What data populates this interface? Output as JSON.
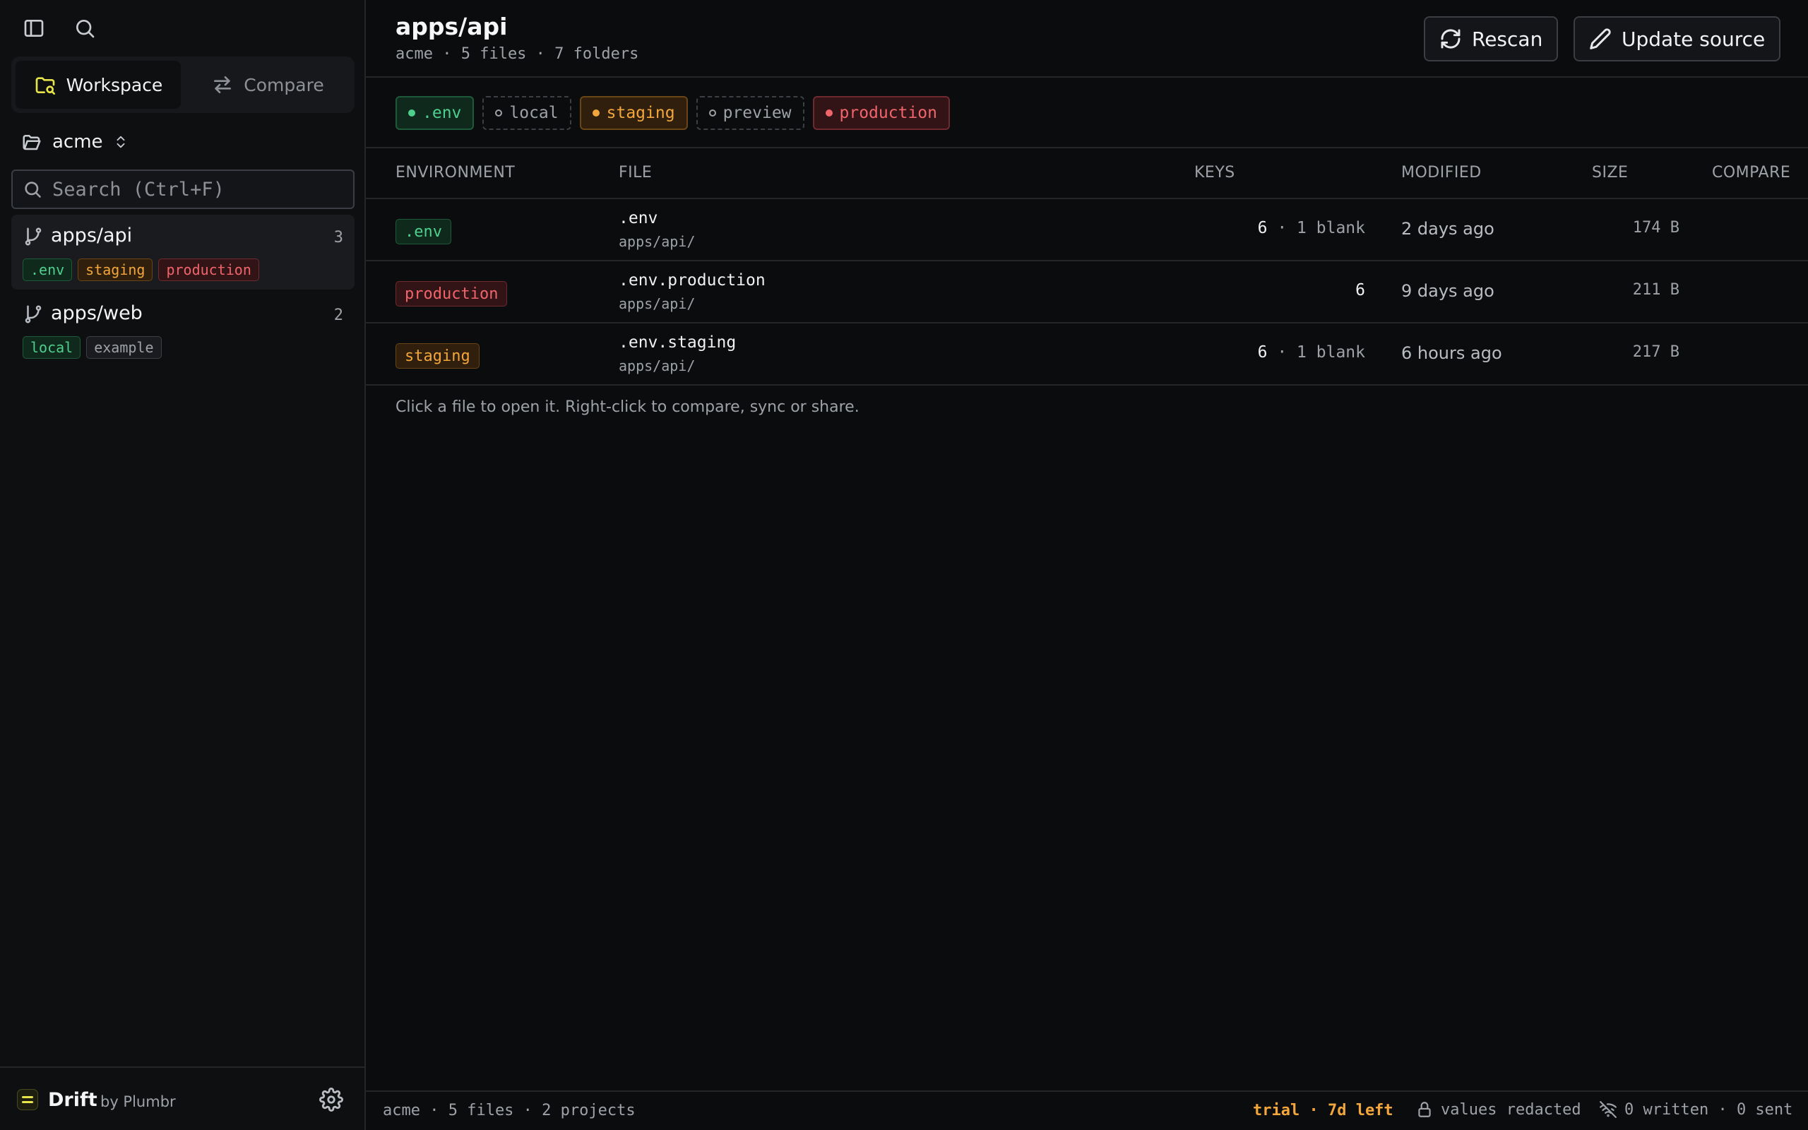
{
  "sidebar": {
    "segments": [
      {
        "label": "Workspace",
        "icon": "folder-search-icon",
        "active": true
      },
      {
        "label": "Compare",
        "icon": "arrows-swap-icon",
        "active": false
      }
    ],
    "workspace": "acme",
    "search": {
      "placeholder": "Search (Ctrl+F)",
      "value": ""
    },
    "projects": [
      {
        "name": "apps/api",
        "count": "3",
        "tags": [
          ".env",
          "staging",
          "production"
        ]
      },
      {
        "name": "apps/web",
        "count": "2",
        "tags": [
          "local",
          "example"
        ]
      }
    ],
    "footer": {
      "brand": "Drift",
      "byline": "by Plumbr"
    }
  },
  "header": {
    "title": "apps/api",
    "subtitle": "acme · 5 files · 7 folders",
    "rescan_label": "Rescan",
    "update_label": "Update source"
  },
  "env_chips": [
    {
      "label": ".env",
      "style": "green"
    },
    {
      "label": "local",
      "style": "dashed"
    },
    {
      "label": "staging",
      "style": "orange"
    },
    {
      "label": "preview",
      "style": "dashed"
    },
    {
      "label": "production",
      "style": "red"
    }
  ],
  "table": {
    "columns": {
      "environment": "ENVIRONMENT",
      "file": "FILE",
      "keys": "KEYS",
      "modified": "MODIFIED",
      "size": "SIZE",
      "compare": "COMPARE"
    },
    "rows": [
      {
        "env": ".env",
        "file": ".env",
        "path": "apps/api/",
        "keys": "6",
        "blank": " · 1 blank",
        "modified": "2 days ago",
        "size": "174 B"
      },
      {
        "env": "production",
        "file": ".env.production",
        "path": "apps/api/",
        "keys": "6",
        "blank": "",
        "modified": "9 days ago",
        "size": "211 B"
      },
      {
        "env": "staging",
        "file": ".env.staging",
        "path": "apps/api/",
        "keys": "6",
        "blank": " · 1 blank",
        "modified": "6 hours ago",
        "size": "217 B"
      }
    ]
  },
  "hint": "Click a file to open it. Right-click to compare, sync or share.",
  "statusbar": {
    "left": "acme · 5 files · 2 projects",
    "trial": "trial · 7d left",
    "redacted": "values redacted",
    "sent": "0 written · 0 sent"
  },
  "colors": {
    "green": "#4fcf8d",
    "orange": "#f2a63c",
    "red": "#f0656b",
    "brand": "#e8e54a"
  }
}
